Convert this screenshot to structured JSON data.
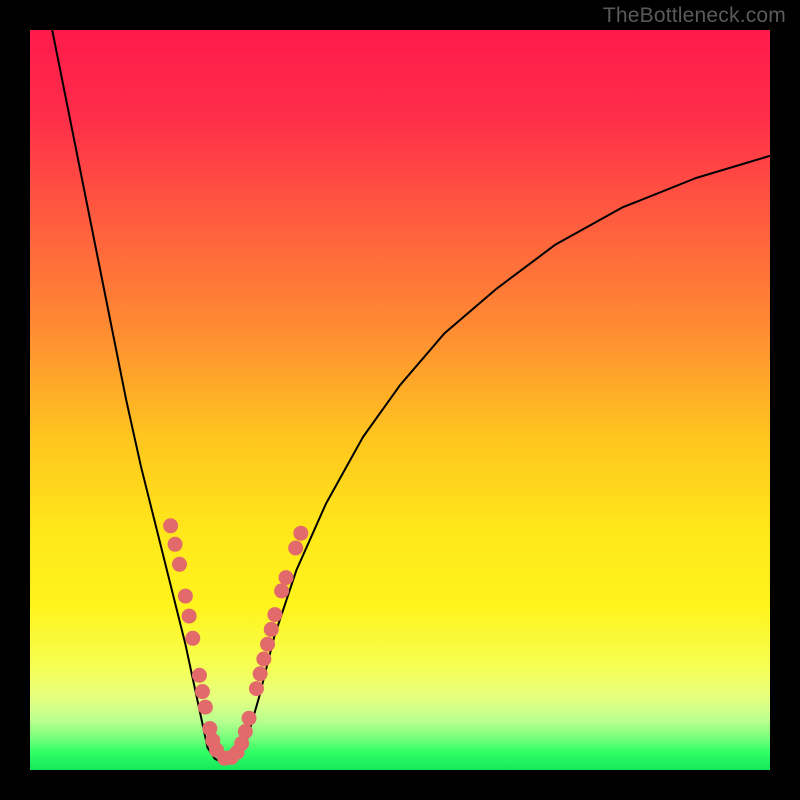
{
  "watermark": "TheBottleneck.com",
  "gradient_stops": [
    {
      "offset": 0.0,
      "color": "#ff1a4b"
    },
    {
      "offset": 0.12,
      "color": "#ff2e4a"
    },
    {
      "offset": 0.25,
      "color": "#ff5a3f"
    },
    {
      "offset": 0.4,
      "color": "#ff8a33"
    },
    {
      "offset": 0.55,
      "color": "#ffc51f"
    },
    {
      "offset": 0.68,
      "color": "#ffe81a"
    },
    {
      "offset": 0.78,
      "color": "#fff41c"
    },
    {
      "offset": 0.86,
      "color": "#f6ff53"
    },
    {
      "offset": 0.905,
      "color": "#e4ff82"
    },
    {
      "offset": 0.935,
      "color": "#b6ff8e"
    },
    {
      "offset": 0.958,
      "color": "#74ff7a"
    },
    {
      "offset": 0.975,
      "color": "#33ff66"
    },
    {
      "offset": 1.0,
      "color": "#14e85a"
    }
  ],
  "chart_data": {
    "type": "line",
    "title": "",
    "xlabel": "",
    "ylabel": "",
    "xlim": [
      0,
      100
    ],
    "ylim": [
      0,
      100
    ],
    "grid": false,
    "legend": false,
    "series": [
      {
        "name": "left-arm",
        "color": "#000000",
        "x": [
          3,
          5,
          7,
          9,
          11,
          13,
          15,
          17,
          19,
          21,
          22.5,
          24
        ],
        "y": [
          100,
          90,
          80,
          70,
          60,
          50,
          41,
          33,
          25,
          17,
          10,
          3
        ]
      },
      {
        "name": "valley",
        "color": "#000000",
        "x": [
          24,
          25,
          26,
          27,
          28,
          29
        ],
        "y": [
          3,
          1.5,
          1,
          1,
          1.5,
          3
        ]
      },
      {
        "name": "right-arm",
        "color": "#000000",
        "x": [
          29,
          31,
          33,
          36,
          40,
          45,
          50,
          56,
          63,
          71,
          80,
          90,
          100
        ],
        "y": [
          3,
          10,
          18,
          27,
          36,
          45,
          52,
          59,
          65,
          71,
          76,
          80,
          83
        ]
      }
    ],
    "markers": {
      "name": "dot-overlay",
      "color": "#e26a6a",
      "radius_px": 7.5,
      "points": [
        {
          "x": 19.0,
          "y": 33.0
        },
        {
          "x": 19.6,
          "y": 30.5
        },
        {
          "x": 20.2,
          "y": 27.8
        },
        {
          "x": 21.0,
          "y": 23.5
        },
        {
          "x": 21.5,
          "y": 20.8
        },
        {
          "x": 22.0,
          "y": 17.8
        },
        {
          "x": 22.9,
          "y": 12.8
        },
        {
          "x": 23.3,
          "y": 10.6
        },
        {
          "x": 23.7,
          "y": 8.5
        },
        {
          "x": 24.3,
          "y": 5.6
        },
        {
          "x": 24.7,
          "y": 4.0
        },
        {
          "x": 25.2,
          "y": 2.7
        },
        {
          "x": 26.3,
          "y": 1.6
        },
        {
          "x": 27.2,
          "y": 1.7
        },
        {
          "x": 28.0,
          "y": 2.4
        },
        {
          "x": 28.6,
          "y": 3.6
        },
        {
          "x": 29.1,
          "y": 5.2
        },
        {
          "x": 29.6,
          "y": 7.0
        },
        {
          "x": 30.6,
          "y": 11.0
        },
        {
          "x": 31.1,
          "y": 13.0
        },
        {
          "x": 31.6,
          "y": 15.0
        },
        {
          "x": 32.1,
          "y": 17.0
        },
        {
          "x": 32.6,
          "y": 19.0
        },
        {
          "x": 33.1,
          "y": 21.0
        },
        {
          "x": 34.0,
          "y": 24.2
        },
        {
          "x": 34.6,
          "y": 26.0
        },
        {
          "x": 35.9,
          "y": 30.0
        },
        {
          "x": 36.6,
          "y": 32.0
        }
      ]
    }
  }
}
